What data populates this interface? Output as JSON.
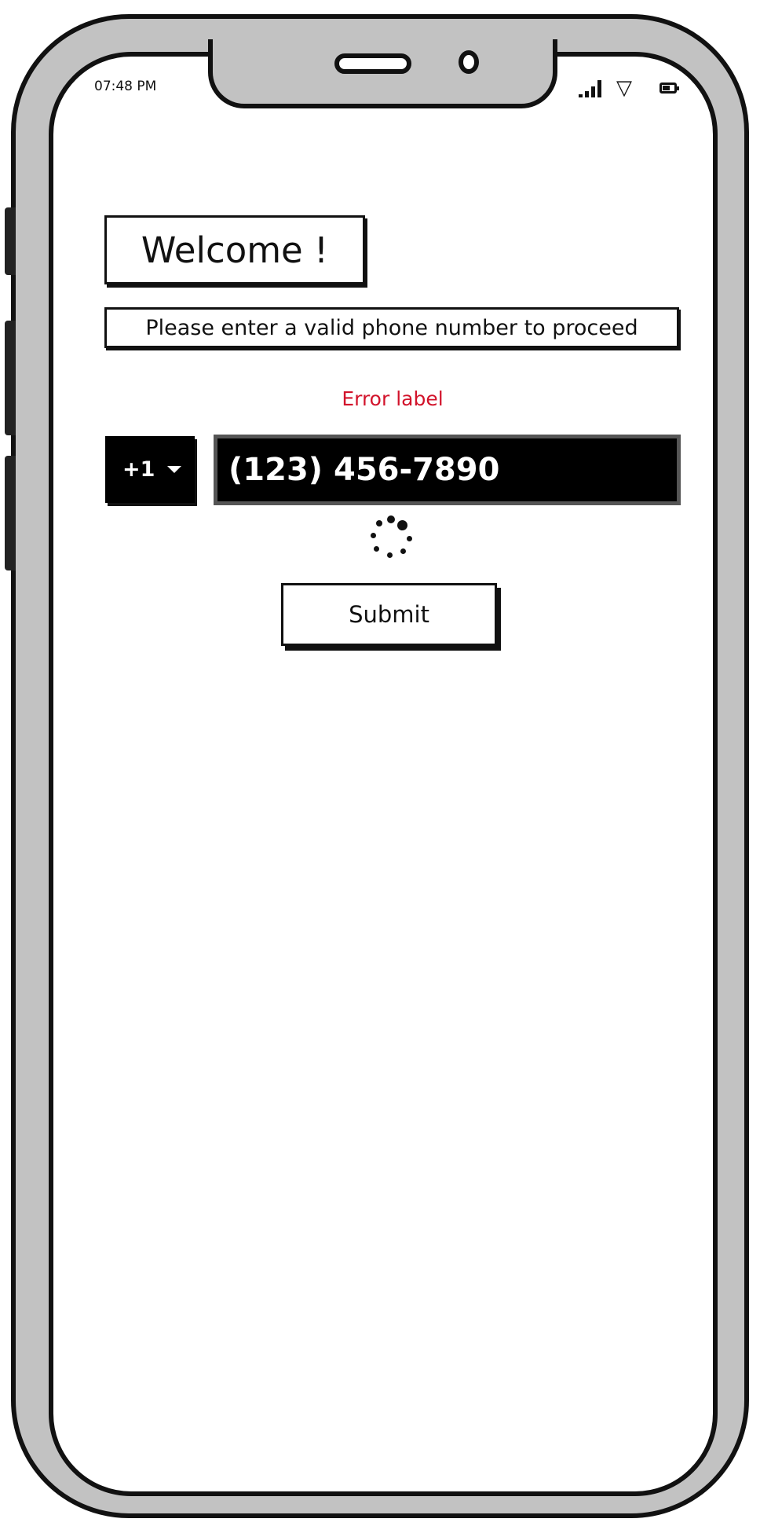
{
  "status_bar": {
    "time": "07:48 PM",
    "signal_icon": "signal-icon",
    "wifi_icon": "wifi-icon",
    "battery_icon": "battery-icon"
  },
  "content": {
    "welcome_title": "Welcome !",
    "instruction": "Please enter a valid phone number to proceed",
    "error_label": "Error label",
    "country_code": "+1",
    "phone_number_value": "(123) 456-7890",
    "submit_label": "Submit"
  },
  "colors": {
    "error": "#d2132b",
    "frame": "#c2c2c2",
    "input_background": "#000000"
  }
}
